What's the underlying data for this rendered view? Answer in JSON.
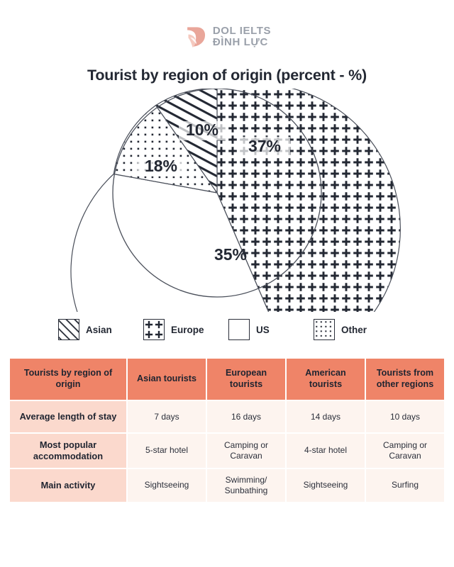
{
  "brand": {
    "logo_icon": "dol-swirl-logo-icon",
    "line1": "DOL IELTS",
    "line2": "ĐÌNH LỰC",
    "color": "#e9a69a"
  },
  "chart_title": "Tourist by region of origin (percent - %)",
  "chart_data": {
    "type": "pie",
    "title": "Tourist by region of origin (percent - %)",
    "categories": [
      "Europe",
      "US",
      "Other",
      "Asian"
    ],
    "values": [
      37,
      35,
      18,
      10
    ],
    "labels": [
      "37%",
      "35%",
      "18%",
      "10%"
    ],
    "unit": "percent",
    "start_angle_deg": 0,
    "direction": "clockwise",
    "legend_position": "bottom",
    "patterns": {
      "Asian": "diagonal-stripes",
      "Europe": "plus-signs",
      "US": "blank",
      "Other": "dots"
    },
    "slice_order_clockwise": [
      {
        "name": "Europe",
        "value": 37,
        "label": "37%",
        "pattern": "plus-signs"
      },
      {
        "name": "US",
        "value": 35,
        "label": "35%",
        "pattern": "blank"
      },
      {
        "name": "Other",
        "value": 18,
        "label": "18%",
        "pattern": "dots"
      },
      {
        "name": "Asian",
        "value": 10,
        "label": "10%",
        "pattern": "diagonal-stripes"
      }
    ]
  },
  "legend": [
    {
      "label": "Asian",
      "pattern": "diagonal-stripes"
    },
    {
      "label": "Europe",
      "pattern": "plus-signs"
    },
    {
      "label": "US",
      "pattern": "blank"
    },
    {
      "label": "Other",
      "pattern": "dots"
    }
  ],
  "table": {
    "headers": [
      "Tourists by region of origin",
      "Asian tourists",
      "European tourists",
      "American tourists",
      "Tourists from other regions"
    ],
    "rows": [
      {
        "label": "Average length of stay",
        "cells": [
          "7 days",
          "16 days",
          "14 days",
          "10 days"
        ]
      },
      {
        "label": "Most popular accommodation",
        "cells": [
          "5-star hotel",
          "Camping or Caravan",
          "4-star hotel",
          "Camping or Caravan"
        ]
      },
      {
        "label": "Main activity",
        "cells": [
          "Sightseeing",
          "Swimming/ Sunbathing",
          "Sightseeing",
          "Surfing"
        ]
      }
    ]
  },
  "colors": {
    "header_bg": "#ef8468",
    "row_head_bg": "#fbd9cd",
    "cell_bg": "#fdf4ef",
    "text": "#232833",
    "stroke": "#4a4f5a"
  }
}
